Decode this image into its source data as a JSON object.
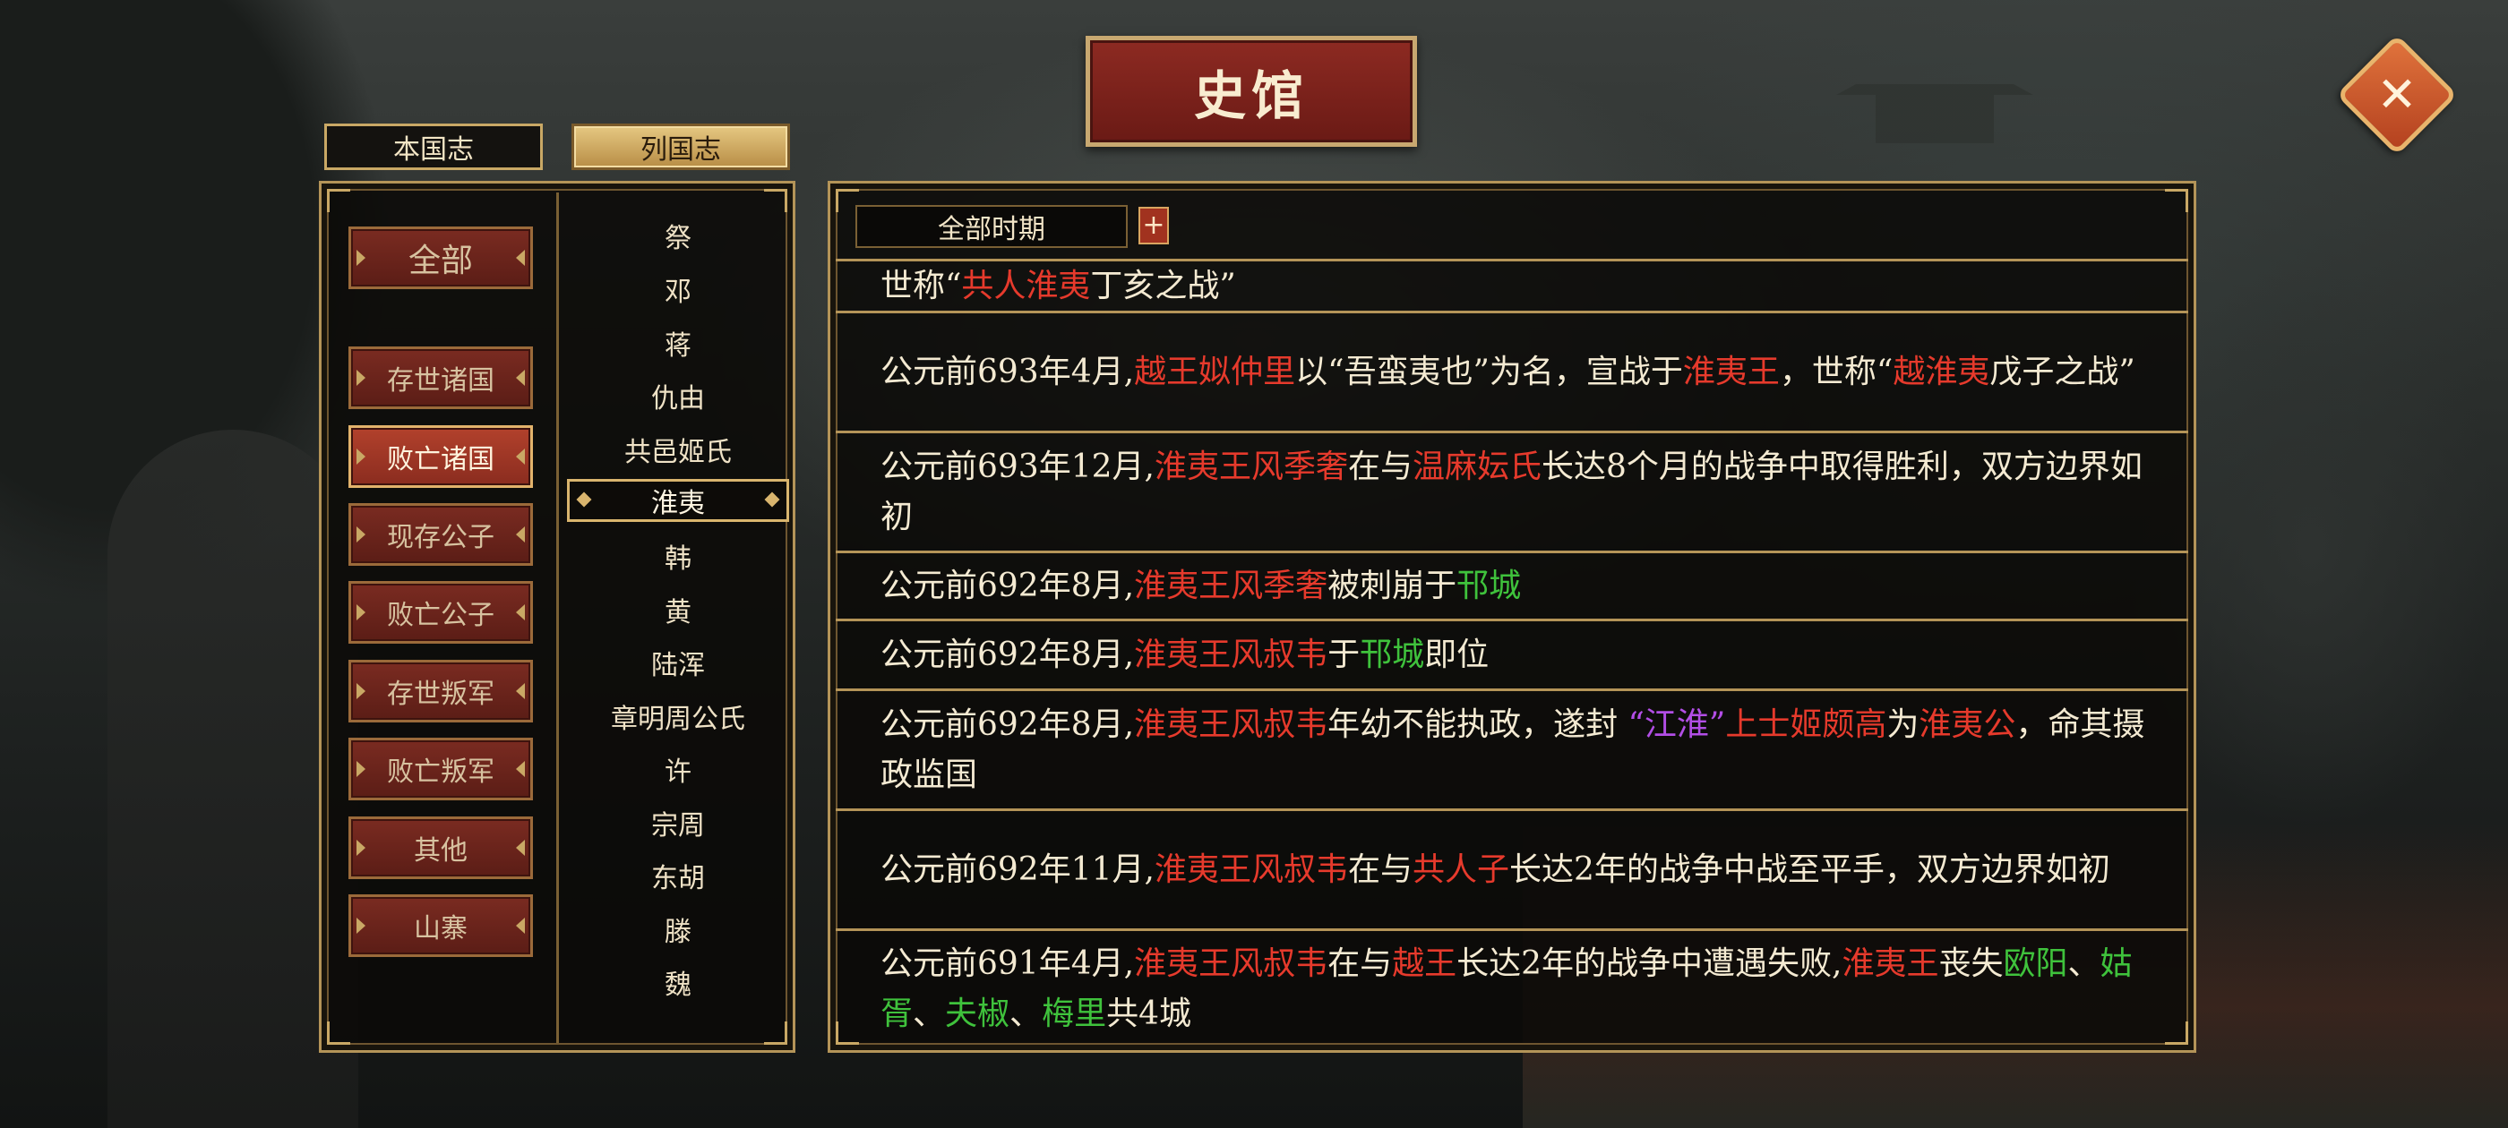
{
  "title": "史馆",
  "close_symbol": "✕",
  "tabs": [
    "本国志",
    "列国志"
  ],
  "categories": [
    "全部",
    "存世诸国",
    "败亡诸国",
    "现存公子",
    "败亡公子",
    "存世叛军",
    "败亡叛军",
    "其他",
    "山寨"
  ],
  "selected_category": "败亡诸国",
  "nations": [
    "祭",
    "邓",
    "蒋",
    "仇由",
    "共邑姬氏",
    "淮夷",
    "韩",
    "黄",
    "陆浑",
    "章明周公氏",
    "许",
    "宗周",
    "东胡",
    "滕",
    "魏"
  ],
  "selected_nation": "淮夷",
  "filter": {
    "label": "全部时期",
    "add": "+"
  },
  "entries": [
    [
      {
        "t": "世称“"
      },
      {
        "t": "共人淮夷",
        "c": "r"
      },
      {
        "t": "丁亥之战”"
      }
    ],
    [
      {
        "t": "公元前693年4月,"
      },
      {
        "t": "越王姒仲里",
        "c": "r"
      },
      {
        "t": "以“吾蛮夷也”为名，宣战于"
      },
      {
        "t": "淮夷王",
        "c": "r"
      },
      {
        "t": "，世称“"
      },
      {
        "t": "越淮夷",
        "c": "r"
      },
      {
        "t": "戊子之战”"
      }
    ],
    [
      {
        "t": "公元前693年12月,"
      },
      {
        "t": "淮夷王风季奢",
        "c": "r"
      },
      {
        "t": "在与"
      },
      {
        "t": "温麻妘氏",
        "c": "r"
      },
      {
        "t": "长达8个月的战争中取得胜利，双方边界如初"
      }
    ],
    [
      {
        "t": "公元前692年8月,"
      },
      {
        "t": "淮夷王风季奢",
        "c": "r"
      },
      {
        "t": "被刺崩于"
      },
      {
        "t": "邗城",
        "c": "g"
      }
    ],
    [
      {
        "t": "公元前692年8月,"
      },
      {
        "t": "淮夷王风叔韦",
        "c": "r"
      },
      {
        "t": "于"
      },
      {
        "t": "邗城",
        "c": "g"
      },
      {
        "t": "即位"
      }
    ],
    [
      {
        "t": "公元前692年8月,"
      },
      {
        "t": "淮夷王风叔韦",
        "c": "r"
      },
      {
        "t": "年幼不能执政，遂封 "
      },
      {
        "t": "“江淮”",
        "c": "p"
      },
      {
        "t": "上士姬颇高",
        "c": "r"
      },
      {
        "t": "为"
      },
      {
        "t": "淮夷公",
        "c": "r"
      },
      {
        "t": "，命其摄政监国"
      }
    ],
    [
      {
        "t": "公元前692年11月,"
      },
      {
        "t": "淮夷王风叔韦",
        "c": "r"
      },
      {
        "t": "在与"
      },
      {
        "t": "共人子",
        "c": "r"
      },
      {
        "t": "长达2年的战争中战至平手，双方边界如初"
      }
    ],
    [
      {
        "t": "公元前691年4月,"
      },
      {
        "t": "淮夷王风叔韦",
        "c": "r"
      },
      {
        "t": "在与"
      },
      {
        "t": "越王",
        "c": "r"
      },
      {
        "t": "长达2年的战争中遭遇失败,"
      },
      {
        "t": "淮夷王",
        "c": "r"
      },
      {
        "t": "丧失"
      },
      {
        "t": "欧阳",
        "c": "g"
      },
      {
        "t": "、"
      },
      {
        "t": "姑胥",
        "c": "g"
      },
      {
        "t": "、"
      },
      {
        "t": "夫椒",
        "c": "g"
      },
      {
        "t": "、"
      },
      {
        "t": "梅里",
        "c": "g"
      },
      {
        "t": "共4城"
      }
    ]
  ]
}
